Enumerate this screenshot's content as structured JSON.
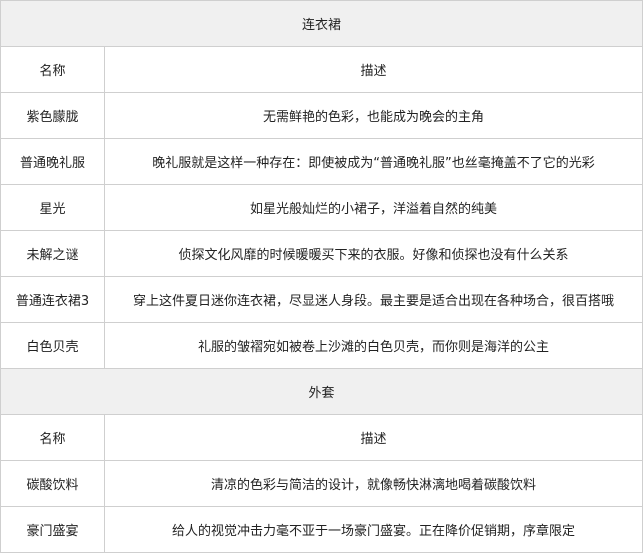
{
  "sections": [
    {
      "title": "连衣裙",
      "header": {
        "name": "名称",
        "desc": "描述"
      },
      "rows": [
        {
          "name": "紫色朦胧",
          "desc": "无需鲜艳的色彩，也能成为晚会的主角"
        },
        {
          "name": "普通晚礼服",
          "desc": "晚礼服就是这样一种存在：即使被成为“普通晚礼服”也丝毫掩盖不了它的光彩"
        },
        {
          "name": "星光",
          "desc": "如星光般灿烂的小裙子，洋溢着自然的纯美"
        },
        {
          "name": "未解之谜",
          "desc": "侦探文化风靡的时候暖暖买下来的衣服。好像和侦探也没有什么关系"
        },
        {
          "name": "普通连衣裙3",
          "desc": "穿上这件夏日迷你连衣裙，尽显迷人身段。最主要是适合出现在各种场合，很百搭哦"
        },
        {
          "name": "白色贝壳",
          "desc": "礼服的皱褶宛如被卷上沙滩的白色贝壳，而你则是海洋的公主"
        }
      ]
    },
    {
      "title": "外套",
      "header": {
        "name": "名称",
        "desc": "描述"
      },
      "rows": [
        {
          "name": "碳酸饮料",
          "desc": "清凉的色彩与简洁的设计，就像畅快淋漓地喝着碳酸饮料"
        },
        {
          "name": "豪门盛宴",
          "desc": "给人的视觉冲击力毫不亚于一场豪门盛宴。正在降价促销期，序章限定"
        }
      ]
    }
  ]
}
